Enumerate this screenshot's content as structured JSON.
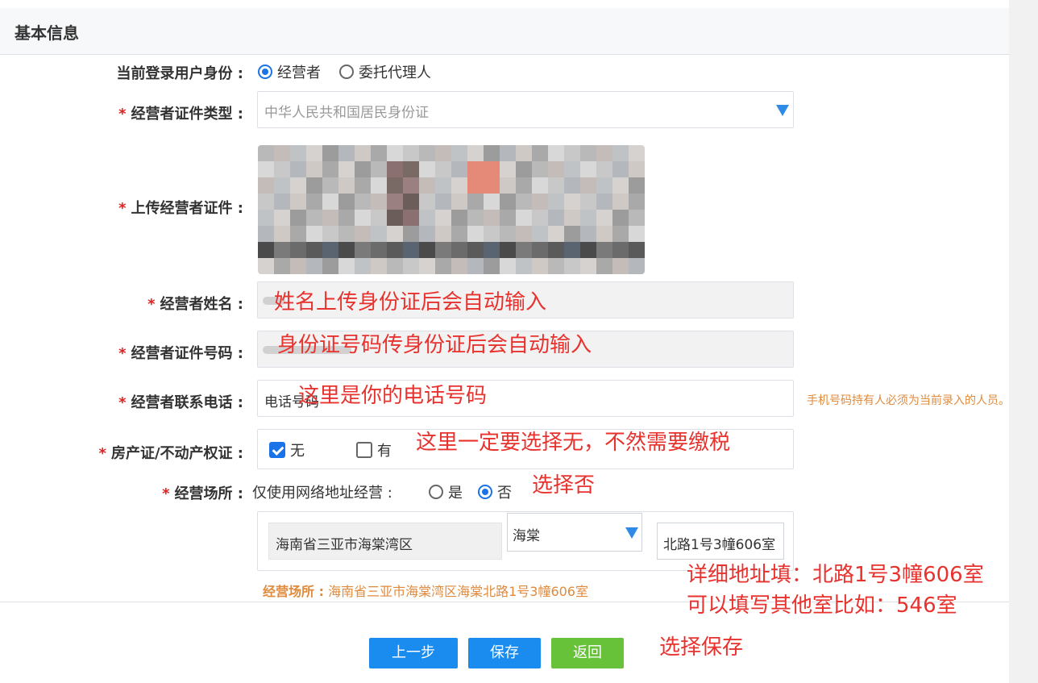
{
  "header": {
    "title": "基本信息"
  },
  "identity": {
    "label": "当前登录用户身份 :",
    "options": [
      {
        "label": "经营者",
        "selected": true
      },
      {
        "label": "委托代理人",
        "selected": false
      }
    ]
  },
  "id_type": {
    "label": "经营者证件类型 :",
    "value": "中华人民共和国居民身份证"
  },
  "upload": {
    "label": "上传经营者证件 :"
  },
  "name": {
    "label": "经营者姓名 :"
  },
  "id_number": {
    "label": "经营者证件号码 :"
  },
  "phone": {
    "label": "经营者联系电话 :",
    "value": "电话号码",
    "hint": "手机号码持有人必须为当前录入的人员。"
  },
  "property": {
    "label": "房产证/不动产权证 :",
    "options": [
      {
        "label": "无",
        "checked": true
      },
      {
        "label": "有",
        "checked": false
      }
    ]
  },
  "premises": {
    "label": "经营场所 :",
    "online_only_label": "仅使用网络地址经营 :",
    "options": [
      {
        "label": "是",
        "selected": false
      },
      {
        "label": "否",
        "selected": true
      }
    ],
    "region": "海南省三亚市海棠湾区",
    "street": "海棠",
    "detail": "北路1号3幢606室",
    "summary_label": "经营场所 :",
    "summary_value": "海南省三亚市海棠湾区海棠北路1号3幢606室"
  },
  "buttons": {
    "prev": "上一步",
    "save": "保存",
    "back": "返回"
  },
  "annotations": {
    "name_auto": "姓名上传身份证后会自动输入",
    "id_auto": "身份证号码传身份证后会自动输入",
    "phone_note": "这里是你的电话号码",
    "property_note": "这里一定要选择无，不然需要缴税",
    "choose_no": "选择否",
    "detail_line1": "详细地址填：北路1号3幢606室",
    "detail_line2": "可以填写其他室比如：546室",
    "choose_save": "选择保存"
  },
  "colors": {
    "primary": "#1a73e8",
    "success": "#67c23a",
    "annotation": "#e8322e",
    "hint": "#e08a3c"
  }
}
